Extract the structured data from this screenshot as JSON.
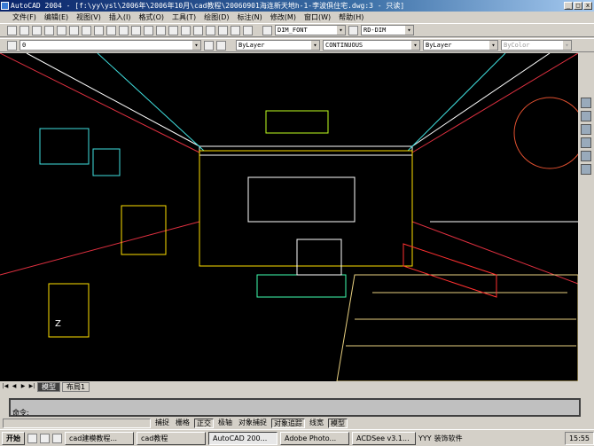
{
  "window": {
    "title": "AutoCAD 2004 - [f:\\yy\\ysl\\2006年\\2006年10月\\cad教程\\20060901海连新天地h-1-李波俱住宅.dwg:3 - 只读]"
  },
  "menu": [
    "文件(F)",
    "编辑(E)",
    "视图(V)",
    "插入(I)",
    "格式(O)",
    "工具(T)",
    "绘图(D)",
    "标注(N)",
    "修改(M)",
    "窗口(W)",
    "帮助(H)"
  ],
  "toolbar": {
    "text_style": "DIM_FONT",
    "dim_style": "RD-DIM",
    "layer": "0",
    "color": "ByLayer",
    "linetype": "CONTINUOUS",
    "lineweight": "ByLayer",
    "plotstyle": "ByColor"
  },
  "tabs": {
    "model": "模型",
    "layout": "布局1"
  },
  "command": {
    "prompt": "命令:"
  },
  "status": [
    "捕捉",
    "栅格",
    "正交",
    "极轴",
    "对象捕捉",
    "对象追踪",
    "线宽",
    "模型"
  ],
  "taskbar": {
    "start": "开始",
    "tasks": [
      "cad建模教程...",
      "cad教程",
      "AutoCAD 200...",
      "Adobe Photo...",
      "ACDSee v3.1..."
    ],
    "extra1": "YYY",
    "extra2": "装饰软件",
    "clock": "15:55"
  },
  "colors": {
    "canvas": "#000000",
    "title": "#0a246a"
  }
}
